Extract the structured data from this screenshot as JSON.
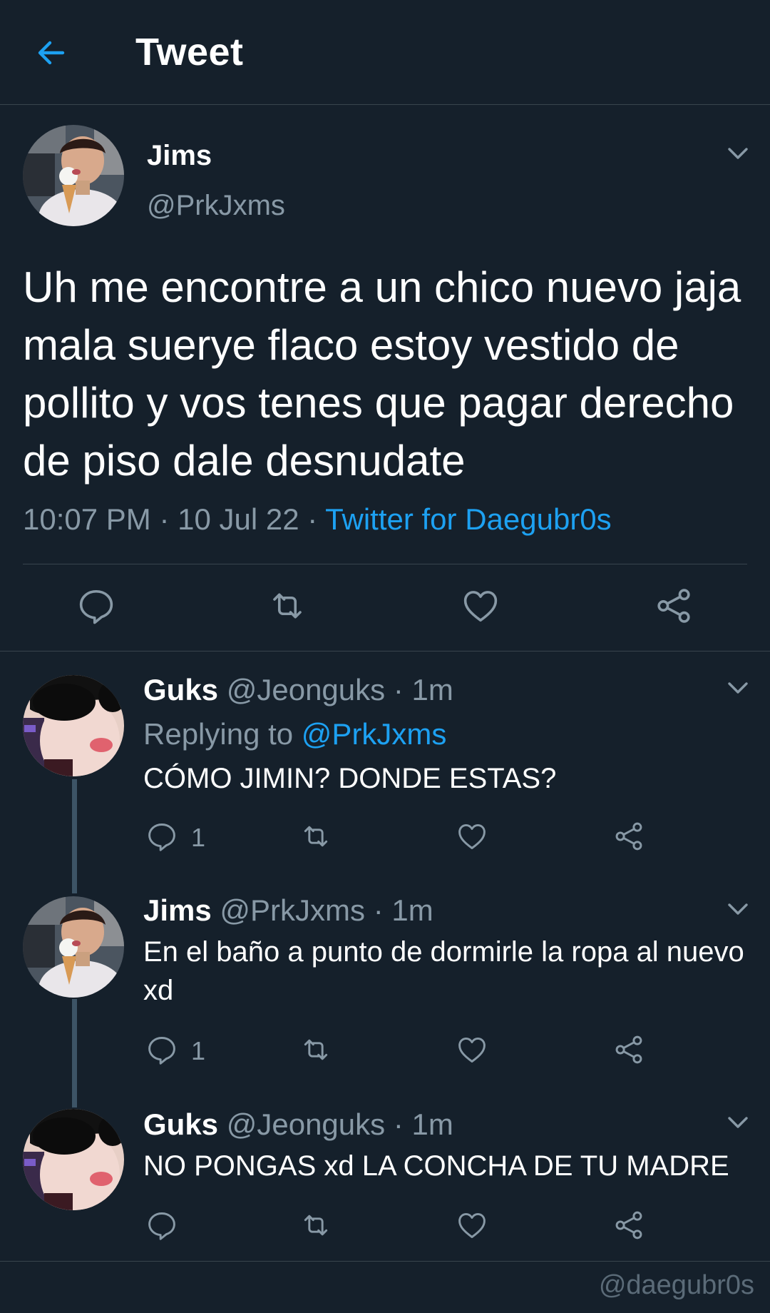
{
  "header": {
    "title": "Tweet"
  },
  "tweet": {
    "name": "Jims",
    "handle": "@PrkJxms",
    "text": "Uh me encontre a un chico nuevo jaja mala suerye flaco estoy vestido de pollito y vos tenes que pagar derecho de piso dale desnudate",
    "time": "10:07 PM",
    "date": "10 Jul 22",
    "source": "Twitter for Daegubr0s",
    "dot": " · "
  },
  "replies": [
    {
      "name": "Guks",
      "handle": "@Jeonguks",
      "time": "1m",
      "replying_label": "Replying to ",
      "replying_to": "@PrkJxms",
      "text": "CÓMO JIMIN? DONDE ESTAS?",
      "reply_count": "1"
    },
    {
      "name": "Jims",
      "handle": "@PrkJxms",
      "time": "1m",
      "text": "En el baño a punto de dormirle la ropa al nuevo xd",
      "reply_count": "1"
    },
    {
      "name": "Guks",
      "handle": "@Jeonguks",
      "time": "1m",
      "text": "NO PONGAS xd LA CONCHA DE TU MADRE"
    }
  ],
  "watermark": "@daegubr0s",
  "icons": {
    "back": "arrow-left-icon",
    "reply": "comment-bubble-icon",
    "retweet": "retweet-icon",
    "like": "heart-icon",
    "share": "share-icon",
    "more": "chevron-down-icon"
  },
  "colors": {
    "background": "#15202b",
    "accent": "#1da1f2",
    "secondary_text": "#8899a6",
    "divider": "#38444d"
  }
}
